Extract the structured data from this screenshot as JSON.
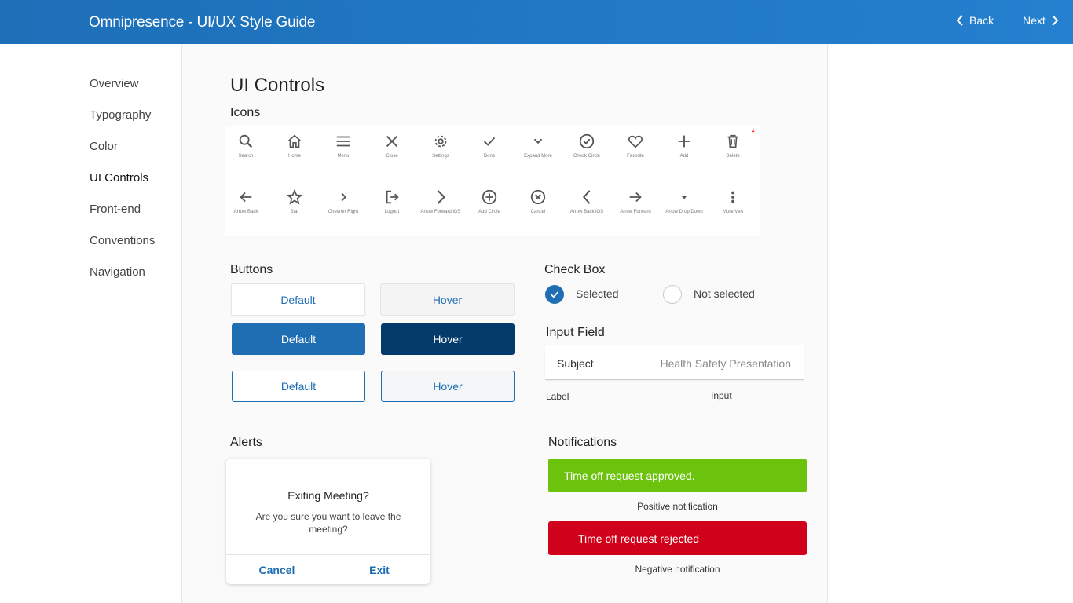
{
  "header": {
    "title": "Omnipresence - UI/UX Style Guide",
    "back_label": "Back",
    "next_label": "Next"
  },
  "sidebar": {
    "items": [
      {
        "label": "Overview"
      },
      {
        "label": "Typography"
      },
      {
        "label": "Color"
      },
      {
        "label": "UI Controls",
        "active": true
      },
      {
        "label": "Front-end"
      },
      {
        "label": "Conventions"
      },
      {
        "label": "Navigation"
      }
    ]
  },
  "page": {
    "title": "UI Controls",
    "icons_heading": "Icons",
    "asterisk": "*",
    "icons": [
      {
        "name": "search-icon",
        "label": "Search"
      },
      {
        "name": "home-icon",
        "label": "Home"
      },
      {
        "name": "menu-icon",
        "label": "Menu"
      },
      {
        "name": "close-icon",
        "label": "Close"
      },
      {
        "name": "settings-icon",
        "label": "Settings"
      },
      {
        "name": "done-icon",
        "label": "Done"
      },
      {
        "name": "expand-more-icon",
        "label": "Expand More"
      },
      {
        "name": "check-circle-icon",
        "label": "Check Circle"
      },
      {
        "name": "favorite-icon",
        "label": "Favorite"
      },
      {
        "name": "add-icon",
        "label": "Add"
      },
      {
        "name": "delete-icon",
        "label": "Delete"
      },
      {
        "name": "arrow-back-icon",
        "label": "Arrow Back"
      },
      {
        "name": "star-icon",
        "label": "Star"
      },
      {
        "name": "chevron-right-icon",
        "label": "Chevron Right"
      },
      {
        "name": "logout-icon",
        "label": "Logout"
      },
      {
        "name": "arrow-forward-ios-icon",
        "label": "Arrow Forward iOS"
      },
      {
        "name": "add-circle-icon",
        "label": "Add Circle"
      },
      {
        "name": "cancel-icon",
        "label": "Cancel"
      },
      {
        "name": "arrow-back-ios-icon",
        "label": "Arrow Back iOS"
      },
      {
        "name": "arrow-forward-icon",
        "label": "Arrow Forward"
      },
      {
        "name": "arrow-drop-down-icon",
        "label": "Arrow Drop Down"
      },
      {
        "name": "more-vert-icon",
        "label": "More Vert"
      }
    ],
    "buttons": {
      "heading": "Buttons",
      "default_label": "Default",
      "hover_label": "Hover"
    },
    "checkbox": {
      "heading": "Check Box",
      "selected_label": "Selected",
      "not_selected_label": "Not selected"
    },
    "input": {
      "heading": "Input Field",
      "label": "Subject",
      "value": "Health Safety Presentation",
      "caption_label": "Label",
      "caption_input": "Input"
    },
    "alerts": {
      "heading": "Alerts",
      "title": "Exiting Meeting?",
      "message": "Are you sure you want to leave the meeting?",
      "cancel_label": "Cancel",
      "exit_label": "Exit"
    },
    "notifications": {
      "heading": "Notifications",
      "positive_text": "Time off request approved.",
      "positive_caption": "Positive notification",
      "negative_text": "Time off request rejected",
      "negative_caption": "Negative notification"
    }
  },
  "colors": {
    "primary": "#1f6db3",
    "primary_dark": "#033b6a",
    "positive": "#6cc30d",
    "negative": "#d0021b"
  }
}
